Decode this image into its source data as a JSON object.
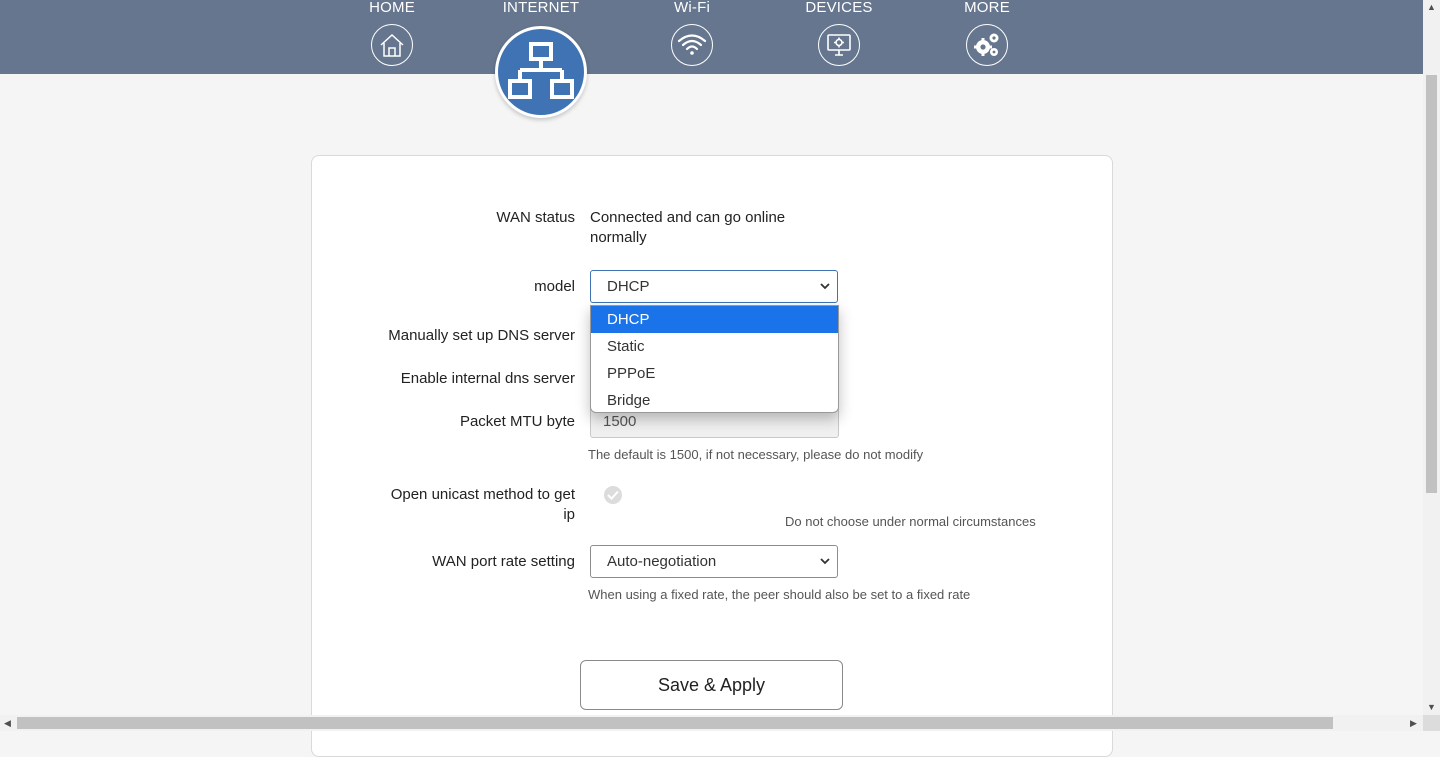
{
  "nav": {
    "items": [
      {
        "label": "HOME",
        "icon": "home-icon"
      },
      {
        "label": "INTERNET",
        "icon": "network-icon"
      },
      {
        "label": "Wi-Fi",
        "icon": "wifi-icon"
      },
      {
        "label": "DEVICES",
        "icon": "devices-icon"
      },
      {
        "label": "MORE",
        "icon": "gears-icon"
      }
    ],
    "active": "INTERNET"
  },
  "form": {
    "wan_status_label": "WAN status",
    "wan_status_value_line1": "Connected and can go online",
    "wan_status_value_line2": "normally",
    "model_label": "model",
    "model_value": "DHCP",
    "model_options": [
      "DHCP",
      "Static",
      "PPPoE",
      "Bridge"
    ],
    "dns_label": "Manually set up DNS server",
    "internal_dns_label": "Enable internal dns server",
    "mtu_label": "Packet MTU byte",
    "mtu_value": "1500",
    "mtu_hint": "The default is 1500, if not necessary, please do not modify",
    "unicast_label_line1": "Open unicast method to get",
    "unicast_label_line2": "ip",
    "unicast_hint": "Do not choose under normal circumstances",
    "wan_rate_label": "WAN port rate setting",
    "wan_rate_value": "Auto-negotiation",
    "wan_rate_hint": "When using a fixed rate, the peer should also be set to a fixed rate",
    "save_label": "Save & Apply"
  },
  "colors": {
    "topbar": "#65768e",
    "active_nav": "#3f73b4",
    "selected_option": "#1a73e8"
  }
}
